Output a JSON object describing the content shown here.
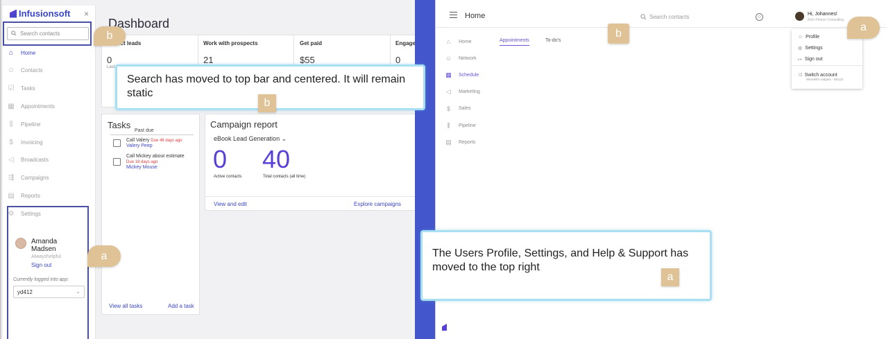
{
  "old_ui": {
    "brand": "Infusionsoft",
    "close": "×",
    "search_placeholder": "Search contacts",
    "nav": [
      {
        "label": "Home",
        "icon": "home-icon"
      },
      {
        "label": "Contacts",
        "icon": "person-icon"
      },
      {
        "label": "Tasks",
        "icon": "checklist-icon"
      },
      {
        "label": "Appointments",
        "icon": "calendar-icon"
      },
      {
        "label": "Pipeline",
        "icon": "pipeline-icon"
      },
      {
        "label": "Invoicing",
        "icon": "dollar-icon"
      },
      {
        "label": "Broadcasts",
        "icon": "megaphone-icon"
      },
      {
        "label": "Campaigns",
        "icon": "campaign-icon"
      },
      {
        "label": "Reports",
        "icon": "report-icon"
      },
      {
        "label": "Settings",
        "icon": "gear-icon"
      }
    ],
    "user": {
      "name": "Amanda Madsen",
      "tagline": "Alwayshelpful",
      "signout": "Sign out"
    },
    "logged_in_label": "Currently logged into app:",
    "app_id": "yd412",
    "page_title": "Dashboard",
    "kpis": [
      {
        "title": "Collect leads",
        "value": "0",
        "sub": "Last 30 days"
      },
      {
        "title": "Work with prospects",
        "value": "21",
        "sub": ""
      },
      {
        "title": "Get paid",
        "value": "$55",
        "sub": ""
      },
      {
        "title": "Engage c",
        "value": "0",
        "sub": ""
      }
    ],
    "tasks": {
      "title": "Tasks",
      "section": "Past due",
      "items": [
        {
          "title": "Call Valery",
          "due": "Due 46 days ago",
          "contact": "Valery Peep"
        },
        {
          "title": "Call Mickey about estimate",
          "due": "Due 18 days ago",
          "contact": "Mickey Mouse"
        }
      ],
      "view_all": "View all tasks",
      "add": "Add a task"
    },
    "campaign": {
      "title": "Campaign report",
      "selected": "eBook Lead Generation",
      "active_value": "0",
      "active_label": "Active contacts",
      "total_value": "40",
      "total_label": "Total contacts (all time)",
      "view_edit": "View and edit",
      "explore": "Explore campaigns"
    }
  },
  "new_ui": {
    "top_title": "Home",
    "search_placeholder": "Search contacts",
    "greeting": "Hi, Johannes!",
    "company": "Rich Pinnon Consulting",
    "dropdown": [
      {
        "label": "Profile",
        "icon": "person-icon"
      },
      {
        "label": "Settings",
        "icon": "gear-icon"
      },
      {
        "label": "Sign out",
        "icon": "signout-icon"
      }
    ],
    "switch_account": "Switch account",
    "switch_sub": "Wendell's widgets - Id0123",
    "tabs": [
      "Appointments",
      "To-do's"
    ],
    "nav": [
      {
        "label": "Home",
        "icon": "home-icon"
      },
      {
        "label": "Network",
        "icon": "person-icon"
      },
      {
        "label": "Schedule",
        "icon": "calendar-icon"
      },
      {
        "label": "Marketing",
        "icon": "megaphone-icon"
      },
      {
        "label": "Sales",
        "icon": "dollar-icon"
      },
      {
        "label": "Pipeline",
        "icon": "pipeline-icon"
      },
      {
        "label": "Reports",
        "icon": "report-icon"
      }
    ]
  },
  "callouts": {
    "b_text": "Search has moved to top bar and centered. It will remain static",
    "a_text": "The Users Profile, Settings, and Help & Support has moved to the top right",
    "b": "b",
    "a": "a"
  },
  "colors": {
    "accent": "#3a46c8",
    "purple": "#6a4fd8",
    "divider": "#4356cc",
    "tag": "#dfc396",
    "callout_border": "#a9dff2"
  }
}
